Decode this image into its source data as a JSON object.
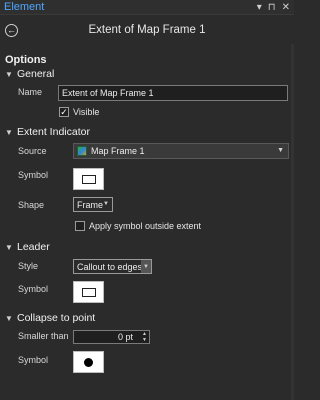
{
  "window": {
    "title": "Element",
    "controls": [
      "▾",
      "🖈",
      "✕"
    ]
  },
  "header": {
    "title": "Extent of Map Frame 1"
  },
  "options_label": "Options",
  "general": {
    "label": "General",
    "name_label": "Name",
    "name_value": "Extent of Map Frame 1",
    "visible_label": "Visible",
    "visible_checked": true
  },
  "extent_indicator": {
    "label": "Extent Indicator",
    "source_label": "Source",
    "source_value": "Map Frame 1",
    "symbol_label": "Symbol",
    "shape_label": "Shape",
    "shape_value": "Frame",
    "apply_outside_label": "Apply symbol outside extent",
    "apply_outside_checked": false
  },
  "leader": {
    "label": "Leader",
    "style_label": "Style",
    "style_value": "Callout to edges",
    "symbol_label": "Symbol"
  },
  "collapse": {
    "label": "Collapse to point",
    "smaller_label": "Smaller than",
    "smaller_value": "0 pt",
    "symbol_label": "Symbol"
  },
  "icons": {
    "back": "back-arrow-icon",
    "section_toggle": "chevron-down-icon",
    "map": "map-frame-icon"
  }
}
